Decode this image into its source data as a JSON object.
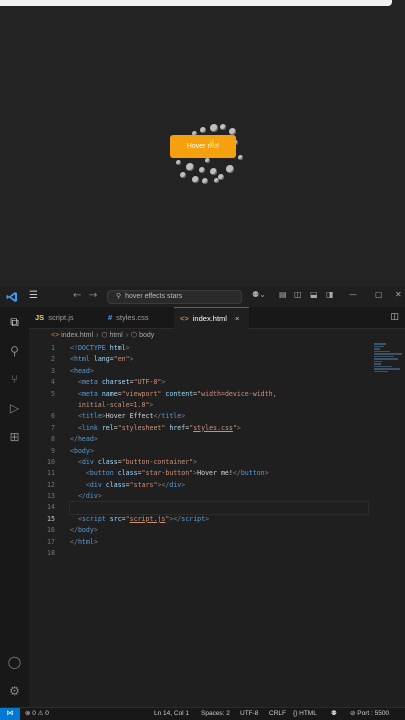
{
  "preview": {
    "button_label": "Hover me!"
  },
  "titlebar": {
    "search_text": "hover effects stars"
  },
  "tabs": [
    {
      "icon": "JS",
      "label": "script.js"
    },
    {
      "icon": "#",
      "label": "styles.css"
    },
    {
      "icon": "<>",
      "label": "index.html",
      "close": "×"
    }
  ],
  "breadcrumb": {
    "file": "index.html",
    "node1": "html",
    "node2": "body"
  },
  "editor": {
    "line_numbers": [
      "1",
      "2",
      "3",
      "4",
      "5",
      "",
      "6",
      "7",
      "8",
      "9",
      "10",
      "11",
      "12",
      "13",
      "14",
      "15",
      "16",
      "17",
      "18"
    ],
    "current_line_index": 15
  },
  "statusbar": {
    "errors": "⊗ 0 ⚠ 0",
    "position": "Ln 14, Col 1",
    "spaces": "Spaces: 2",
    "encoding": "UTF-8",
    "eol": "CRLF",
    "language": "{} HTML",
    "port": "⊘ Port : 5500"
  },
  "colors": {
    "button": "#f5a10f",
    "accent": "#0078d4",
    "tag": "#569cd6",
    "attr": "#9cdcfe",
    "string": "#ce9178"
  }
}
